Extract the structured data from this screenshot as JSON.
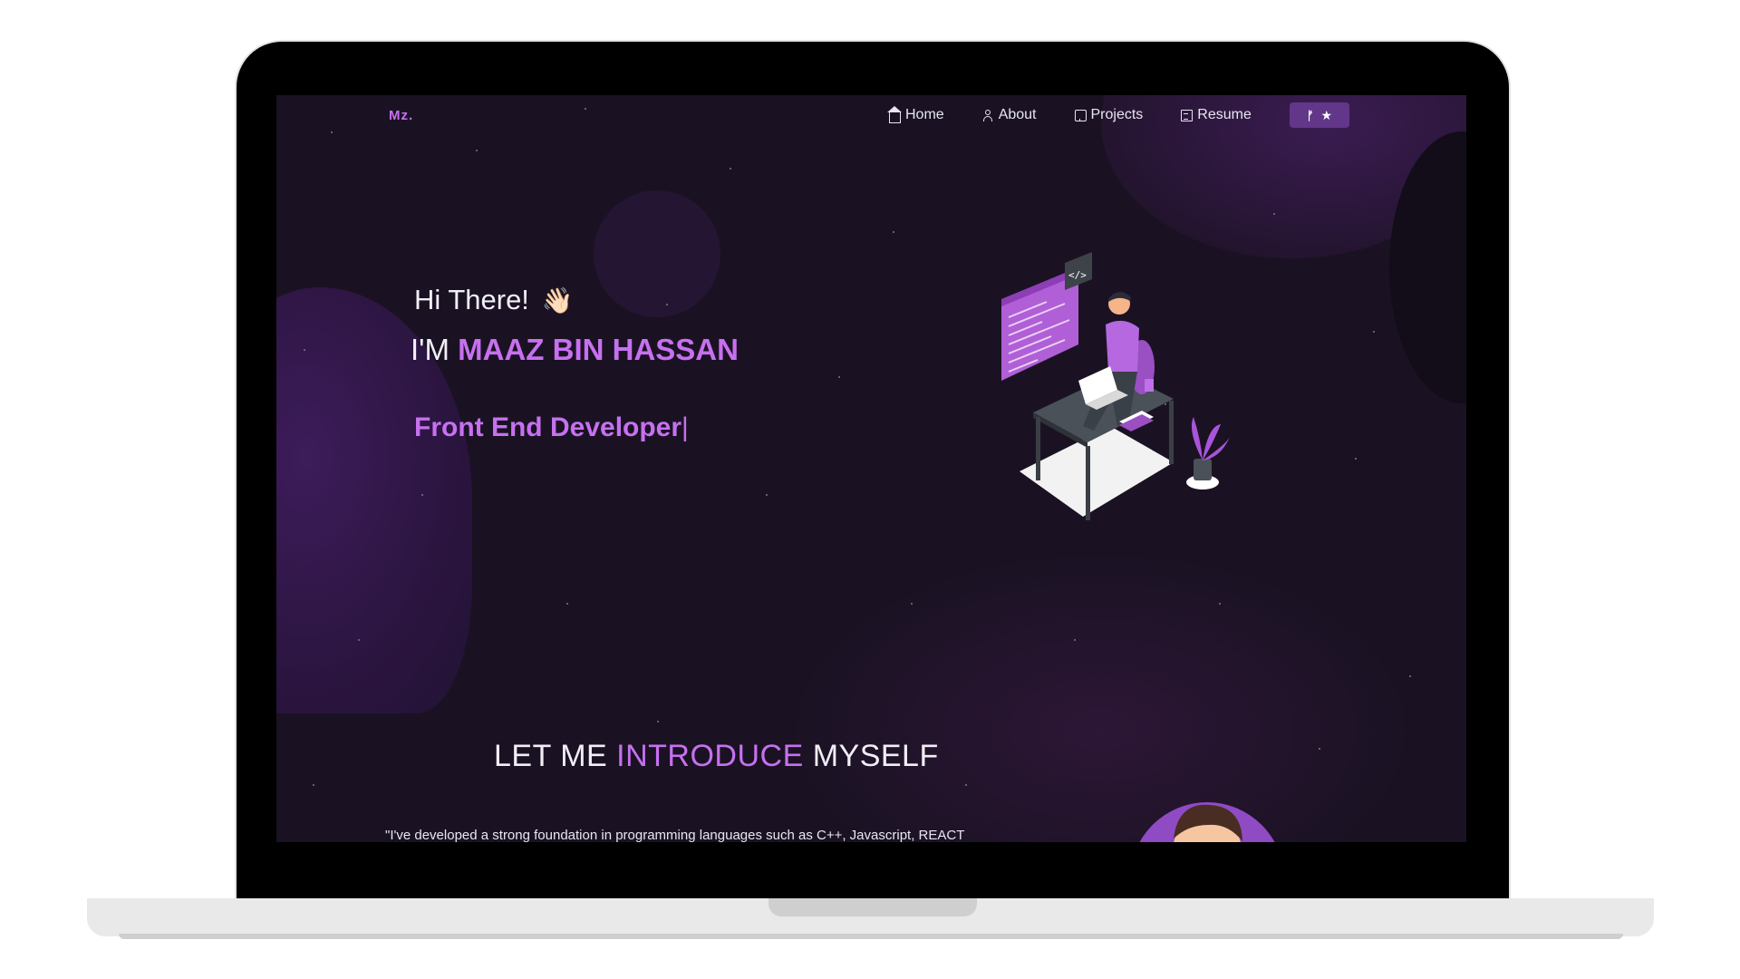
{
  "nav": {
    "logo": "Mz.",
    "items": [
      {
        "label": "Home",
        "icon": "home-icon"
      },
      {
        "label": "About",
        "icon": "user-icon"
      },
      {
        "label": "Projects",
        "icon": "projects-icon"
      },
      {
        "label": "Resume",
        "icon": "document-icon"
      }
    ],
    "github_button": {
      "fork_icon": "fork-icon",
      "star": "★"
    }
  },
  "hero": {
    "greeting": "Hi There!",
    "wave": "👋🏻",
    "name_prefix": "I'M",
    "name": "MAAZ BIN HASSAN",
    "role": "Front End Developer",
    "caret": "|"
  },
  "intro": {
    "title_part1": "LET ME",
    "title_highlight": "INTRODUCE",
    "title_part2": "MYSELF",
    "paragraph": "\"I've developed a strong foundation in programming languages such as C++, Javascript, REACT"
  },
  "colors": {
    "accent": "#c770f0",
    "background": "#1a1223",
    "button": "#62378a"
  }
}
